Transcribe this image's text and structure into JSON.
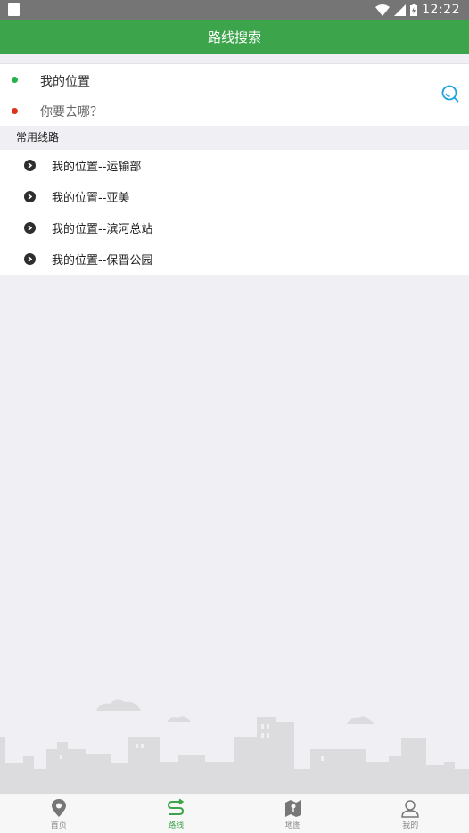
{
  "status_bar": {
    "time": "12:22"
  },
  "header": {
    "title": "路线搜索"
  },
  "search": {
    "from_value": "我的位置",
    "to_placeholder": "你要去哪？"
  },
  "common_routes": {
    "title": "常用线路",
    "items": [
      {
        "label": "我的位置--运输部"
      },
      {
        "label": "我的位置--亚美"
      },
      {
        "label": "我的位置--滨河总站"
      },
      {
        "label": "我的位置--保晋公园"
      }
    ]
  },
  "tabs": [
    {
      "label": "首页",
      "icon": "location-pin-icon"
    },
    {
      "label": "路线",
      "icon": "route-icon",
      "active": true
    },
    {
      "label": "地图",
      "icon": "map-icon"
    },
    {
      "label": "我的",
      "icon": "user-icon"
    }
  ],
  "colors": {
    "accent": "#3ca44a",
    "start_dot": "#22b24c",
    "end_dot": "#e0311f",
    "search_icon": "#1aa1e0"
  }
}
